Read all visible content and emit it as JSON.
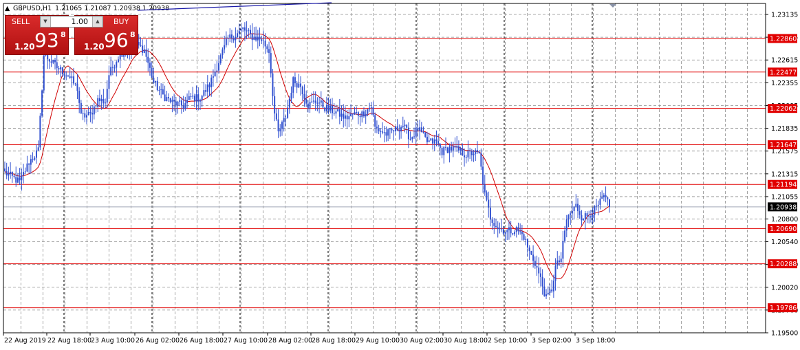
{
  "header": {
    "arrow_icon": "triangle-up-icon",
    "symbol": "GBPUSD,H1",
    "ohlc": "1.21065 1.21087 1.20938 1.20938"
  },
  "trade_panel": {
    "sell_label": "SELL",
    "buy_label": "BUY",
    "lot": "1.00",
    "sell_prefix": "1.20",
    "sell_big": "93",
    "sell_sup": "8",
    "buy_prefix": "1.20",
    "buy_big": "96",
    "buy_sup": "8",
    "color": "#c81414"
  },
  "chart_data": {
    "type": "candlestick",
    "title": "",
    "symbol": "GBPUSD",
    "timeframe": "H1",
    "xlabel": "",
    "ylabel": "",
    "ylim": [
      1.195,
      1.2325
    ],
    "grid": true,
    "y_ticks": [
      "1.23135",
      "1.22875",
      "1.22615",
      "1.22355",
      "1.22095",
      "1.21835",
      "1.21575",
      "1.21315",
      "1.21055",
      "1.20800",
      "1.20540",
      "1.20280",
      "1.20020",
      "1.19760",
      "1.19500"
    ],
    "x_ticks": [
      "22 Aug 2019",
      "22 Aug 18:00",
      "23 Aug 10:00",
      "26 Aug 02:00",
      "26 Aug 18:00",
      "27 Aug 10:00",
      "28 Aug 02:00",
      "28 Aug 18:00",
      "29 Aug 10:00",
      "30 Aug 02:00",
      "30 Aug 18:00",
      "2 Sep 10:00",
      "3 Sep 02:00",
      "3 Sep 18:00"
    ],
    "levels": [
      "1.22860",
      "1.22477",
      "1.22062",
      "1.21647",
      "1.21194",
      "1.20690",
      "1.20288",
      "1.19786"
    ],
    "level_color": "#e10000",
    "current_price": "1.20938",
    "current_color": "#000000",
    "candle_color": "#3050d0",
    "ma_color": "#d00000",
    "path": [
      [
        0,
        1.2133
      ],
      [
        8,
        1.2122
      ],
      [
        13,
        1.2145
      ],
      [
        18,
        1.2158
      ],
      [
        21,
        1.2267
      ],
      [
        24,
        1.2262
      ],
      [
        28,
        1.2253
      ],
      [
        34,
        1.2244
      ],
      [
        39,
        1.2229
      ],
      [
        41,
        1.2197
      ],
      [
        46,
        1.2199
      ],
      [
        50,
        1.2216
      ],
      [
        54,
        1.2214
      ],
      [
        56,
        1.2245
      ],
      [
        62,
        1.227
      ],
      [
        68,
        1.227
      ],
      [
        70,
        1.228
      ],
      [
        75,
        1.2273
      ],
      [
        80,
        1.2236
      ],
      [
        85,
        1.2221
      ],
      [
        90,
        1.2213
      ],
      [
        96,
        1.2209
      ],
      [
        100,
        1.2219
      ],
      [
        105,
        1.2218
      ],
      [
        110,
        1.2233
      ],
      [
        116,
        1.2265
      ],
      [
        120,
        1.2286
      ],
      [
        124,
        1.229
      ],
      [
        128,
        1.2297
      ],
      [
        133,
        1.2288
      ],
      [
        138,
        1.2285
      ],
      [
        142,
        1.2272
      ],
      [
        145,
        1.22
      ],
      [
        147,
        1.2178
      ],
      [
        151,
        1.2197
      ],
      [
        155,
        1.2238
      ],
      [
        159,
        1.2232
      ],
      [
        163,
        1.221
      ],
      [
        168,
        1.2215
      ],
      [
        172,
        1.2207
      ],
      [
        178,
        1.2202
      ],
      [
        183,
        1.2195
      ],
      [
        188,
        1.22
      ],
      [
        192,
        1.22
      ],
      [
        197,
        1.2209
      ],
      [
        199,
        1.2184
      ],
      [
        205,
        1.2177
      ],
      [
        210,
        1.2182
      ],
      [
        214,
        1.2187
      ],
      [
        218,
        1.2172
      ],
      [
        222,
        1.2183
      ],
      [
        227,
        1.2168
      ],
      [
        232,
        1.2168
      ],
      [
        235,
        1.2157
      ],
      [
        239,
        1.2161
      ],
      [
        244,
        1.2158
      ],
      [
        248,
        1.2153
      ],
      [
        252,
        1.2156
      ],
      [
        255,
        1.2153
      ],
      [
        258,
        1.2107
      ],
      [
        261,
        1.2082
      ],
      [
        265,
        1.207
      ],
      [
        270,
        1.2066
      ],
      [
        275,
        1.2068
      ],
      [
        279,
        1.206
      ],
      [
        282,
        1.2042
      ],
      [
        285,
        1.203
      ],
      [
        288,
        1.2011
      ],
      [
        291,
        1.1989
      ],
      [
        294,
        1.2
      ],
      [
        296,
        1.2025
      ],
      [
        299,
        1.2035
      ],
      [
        302,
        1.208
      ],
      [
        307,
        1.2095
      ],
      [
        310,
        1.2083
      ],
      [
        313,
        1.2083
      ],
      [
        318,
        1.2092
      ],
      [
        322,
        1.2105
      ],
      [
        325,
        1.2094
      ]
    ]
  }
}
